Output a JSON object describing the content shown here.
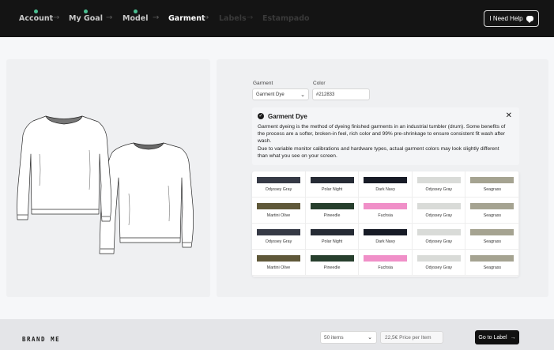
{
  "nav": {
    "steps": [
      {
        "label": "Account",
        "state": "done"
      },
      {
        "label": "My Goal",
        "state": "done"
      },
      {
        "label": "Model",
        "state": "done"
      },
      {
        "label": "Garment",
        "state": "current"
      },
      {
        "label": "Labels",
        "state": "future"
      },
      {
        "label": "Estampado",
        "state": "future"
      }
    ],
    "arrow": "→",
    "help_label": "I Need Help"
  },
  "config": {
    "garment_label": "Garment",
    "garment_value": "Garment Dye",
    "color_label": "Color",
    "color_value": "#212833"
  },
  "info": {
    "title": "Garment Dye",
    "text_1": "Garment dyeing is the method of dyeing finished garments in an industrial tumbler (drum). Some benefits of the process are a softer, broken-in feel, rich color and 99% pre-shrinkage to ensure consistent fit wash after wash.",
    "text_2": "Due to variable monitor calibrations and hardware types, actual garment colors may look slightly different than what you see on your screen.",
    "close": "✕"
  },
  "swatches": [
    [
      {
        "name": "Odyssey Gray",
        "color": "#363a46"
      },
      {
        "name": "Polar Night",
        "color": "#262b35"
      },
      {
        "name": "Dark Navy",
        "color": "#171b26"
      },
      {
        "name": "Odyssey Gray",
        "color": "#d9dbd8"
      },
      {
        "name": "Seagrass",
        "color": "#a5a391"
      }
    ],
    [
      {
        "name": "Martini Olive",
        "color": "#5f5839"
      },
      {
        "name": "Pineedle",
        "color": "#273f2d"
      },
      {
        "name": "Fuchsia",
        "color": "#f08fc8"
      },
      {
        "name": "Odyssey Gray",
        "color": "#d9dbd8"
      },
      {
        "name": "Seagrass",
        "color": "#a5a391"
      }
    ],
    [
      {
        "name": "Odyssey Gray",
        "color": "#363a46"
      },
      {
        "name": "Polar Night",
        "color": "#262b35"
      },
      {
        "name": "Dark Navy",
        "color": "#171b26"
      },
      {
        "name": "Odyssey Gray",
        "color": "#d9dbd8"
      },
      {
        "name": "Seagrass",
        "color": "#a5a391"
      }
    ],
    [
      {
        "name": "Martini Olive",
        "color": "#5f5839"
      },
      {
        "name": "Pineedle",
        "color": "#273f2d"
      },
      {
        "name": "Fuchsia",
        "color": "#f08fc8"
      },
      {
        "name": "Odyssey Gray",
        "color": "#d9dbd8"
      },
      {
        "name": "Seagrass",
        "color": "#a5a391"
      }
    ]
  ],
  "footer": {
    "brand": "BRAND ME",
    "quantity": "50 items",
    "price_placeholder": "22,5€ Price per Item",
    "go_label": "Go to Label"
  }
}
